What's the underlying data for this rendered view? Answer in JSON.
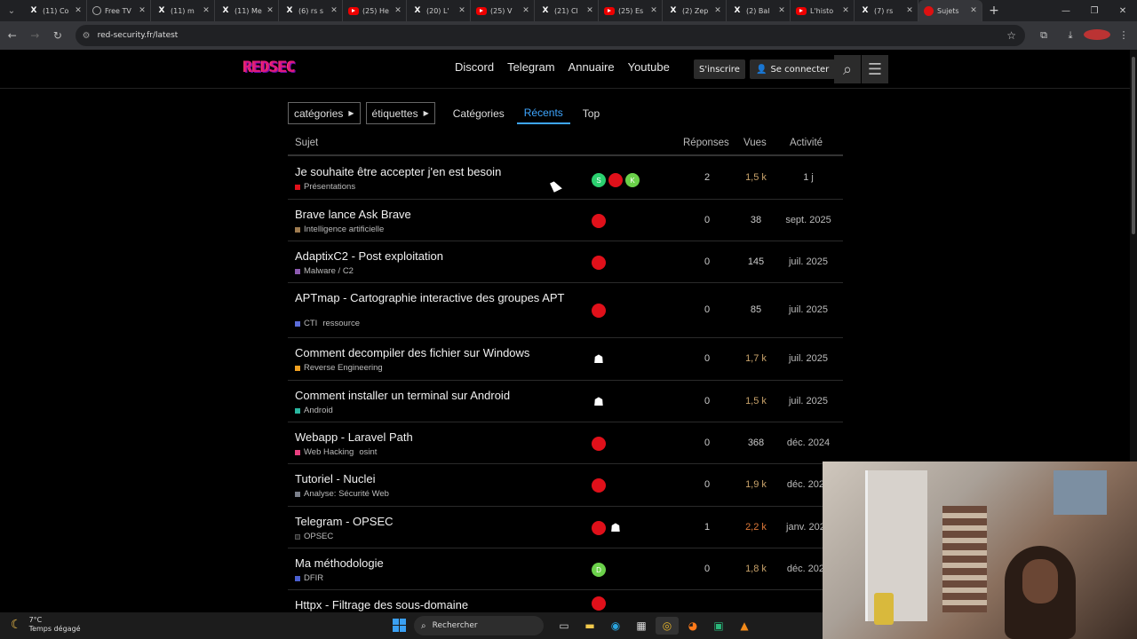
{
  "browser": {
    "tabs": [
      {
        "icon": "x",
        "label": "(11) Co",
        "active": false
      },
      {
        "icon": "ftv",
        "label": "Free TV",
        "active": false
      },
      {
        "icon": "x",
        "label": "(11) m",
        "active": false
      },
      {
        "icon": "x",
        "label": "(11) Me",
        "active": false
      },
      {
        "icon": "x",
        "label": "(6) rs s",
        "active": false
      },
      {
        "icon": "yt",
        "label": "(25) He",
        "active": false
      },
      {
        "icon": "x",
        "label": "(20) L'",
        "active": false
      },
      {
        "icon": "yt",
        "label": "(25) V",
        "active": false
      },
      {
        "icon": "x",
        "label": "(21) Cl",
        "active": false
      },
      {
        "icon": "yt",
        "label": "(25) Es",
        "active": false
      },
      {
        "icon": "x",
        "label": "(2) Zep",
        "active": false
      },
      {
        "icon": "x",
        "label": "(2) Bal",
        "active": false
      },
      {
        "icon": "yt",
        "label": "L'histo",
        "active": false
      },
      {
        "icon": "x",
        "label": "(7) rs",
        "active": false
      },
      {
        "icon": "rs",
        "label": "Sujets",
        "active": true
      }
    ],
    "url": "red-security.fr/latest",
    "new_tab": "+"
  },
  "site": {
    "logo": "REDSEC",
    "links": [
      "Discord",
      "Telegram",
      "Annuaire",
      "Youtube"
    ],
    "signup": "S'inscrire",
    "login": "Se connecter"
  },
  "filters": {
    "categories_dropdown": "catégories",
    "tags_dropdown": "étiquettes",
    "nav": [
      {
        "label": "Catégories",
        "active": false
      },
      {
        "label": "Récents",
        "active": true
      },
      {
        "label": "Top",
        "active": false
      }
    ]
  },
  "table": {
    "headers": {
      "topic": "Sujet",
      "replies": "Réponses",
      "views": "Vues",
      "activity": "Activité"
    },
    "rows": [
      {
        "title": "Je souhaite être accepter j'en est besoin",
        "category": "Présentations",
        "cat_color": "#e0101a",
        "tags": [],
        "posters": [
          "green:S",
          "red:",
          "lgreen:K"
        ],
        "replies": "2",
        "views": "1,5 k",
        "views_heat": 1,
        "activity": "1 j"
      },
      {
        "title": "Brave lance Ask Brave",
        "category": "Intelligence artificielle",
        "cat_color": "#9e7b4f",
        "tags": [],
        "posters": [
          "red:"
        ],
        "replies": "0",
        "views": "38",
        "views_heat": 0,
        "activity": "sept. 2025"
      },
      {
        "title": "AdaptixC2 - Post exploitation",
        "category": "Malware / C2",
        "cat_color": "#8c5ab0",
        "tags": [],
        "posters": [
          "red:"
        ],
        "replies": "0",
        "views": "145",
        "views_heat": 0,
        "activity": "juil. 2025"
      },
      {
        "title": "APTmap - Cartographie interactive des groupes APT",
        "category": "CTI",
        "cat_color": "#5b6cd9",
        "tags": [
          "ressource"
        ],
        "posters": [
          "red:"
        ],
        "replies": "0",
        "views": "85",
        "views_heat": 0,
        "activity": "juil. 2025"
      },
      {
        "title": "Comment decompiler des fichier sur Windows",
        "category": "Reverse Engineering",
        "cat_color": "#f0a020",
        "tags": [],
        "posters": [
          "ghost:"
        ],
        "replies": "0",
        "views": "1,7 k",
        "views_heat": 1,
        "activity": "juil. 2025"
      },
      {
        "title": "Comment installer un terminal sur Android",
        "category": "Android",
        "cat_color": "#2ab7a0",
        "tags": [],
        "posters": [
          "ghost:"
        ],
        "replies": "0",
        "views": "1,5 k",
        "views_heat": 1,
        "activity": "juil. 2025"
      },
      {
        "title": "Webapp - Laravel Path",
        "category": "Web Hacking",
        "cat_color": "#e84080",
        "tags": [
          "osint"
        ],
        "posters": [
          "red:"
        ],
        "replies": "0",
        "views": "368",
        "views_heat": 0,
        "activity": "déc. 2024"
      },
      {
        "title": "Tutoriel - Nuclei",
        "category": "Analyse: Sécurité Web",
        "cat_color": "#7a7f8a",
        "tags": [],
        "posters": [
          "red:"
        ],
        "replies": "0",
        "views": "1,9 k",
        "views_heat": 1,
        "activity": "déc. 2024"
      },
      {
        "title": "Telegram - OPSEC",
        "category": "OPSEC",
        "cat_color": "#222222",
        "tags": [],
        "posters": [
          "red:",
          "ghost:"
        ],
        "replies": "1",
        "views": "2,2 k",
        "views_heat": 2,
        "activity": "janv. 2024"
      },
      {
        "title": "Ma méthodologie",
        "category": "DFIR",
        "cat_color": "#4a5fd0",
        "tags": [],
        "posters": [
          "lgreen:D"
        ],
        "replies": "0",
        "views": "1,8 k",
        "views_heat": 1,
        "activity": "déc. 2023"
      },
      {
        "title": "Httpx - Filtrage des sous-domaine",
        "category": "",
        "cat_color": "#000000",
        "tags": [],
        "posters": [
          "red:"
        ],
        "replies": "",
        "views": "",
        "views_heat": 0,
        "activity": ""
      }
    ]
  },
  "taskbar": {
    "temp": "7°C",
    "weather": "Temps dégagé",
    "search": "Rechercher"
  }
}
